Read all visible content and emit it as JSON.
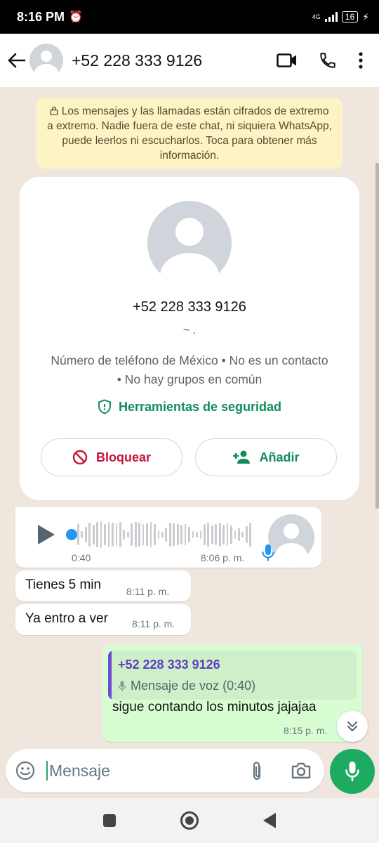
{
  "status_bar": {
    "time": "8:16 PM",
    "network": "4G",
    "battery": "16"
  },
  "header": {
    "contact": "+52 228 333 9126"
  },
  "encryption_notice": "Los mensajes y las llamadas están cifrados de extremo a extremo. Nadie fuera de este chat, ni siquiera WhatsApp, puede leerlos ni escucharlos. Toca para obtener más información.",
  "contact_card": {
    "phone": "+52 228 333 9126",
    "subtitle": "~ .",
    "description": "Número de teléfono de México • No es un contacto • No hay grupos en común",
    "security_tools": "Herramientas de seguridad",
    "block_label": "Bloquear",
    "add_label": "Añadir"
  },
  "messages": {
    "voice": {
      "duration": "0:40",
      "time": "8:06 p. m."
    },
    "text1": {
      "text": "Tienes 5 min",
      "time": "8:11 p. m."
    },
    "text2": {
      "text": "Ya entro a ver",
      "time": "8:11 p. m."
    },
    "reply": {
      "quoted_name": "+52 228 333 9126",
      "quoted_text": "Mensaje de voz (0:40)",
      "text": "sigue contando los minutos jajajaa",
      "time": "8:15 p. m."
    }
  },
  "input": {
    "placeholder": "Mensaje"
  },
  "colors": {
    "accent": "#1daa61",
    "chat_background": "#efe7de",
    "outgoing_bubble": "#d9fdd3",
    "block_red": "#c3163a"
  }
}
